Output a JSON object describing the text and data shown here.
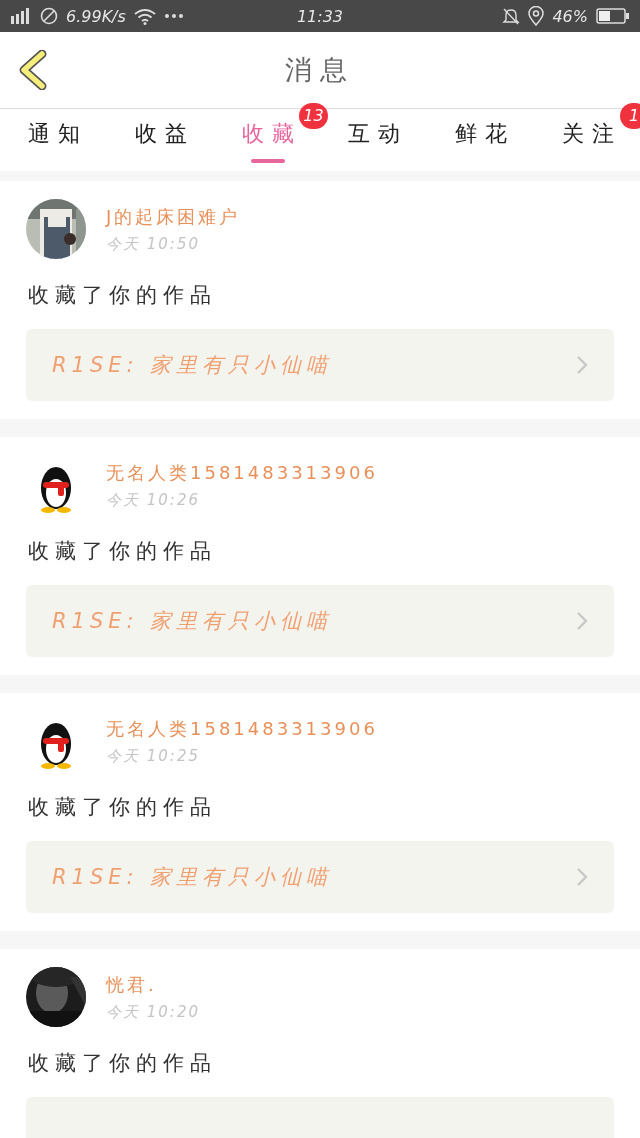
{
  "status_bar": {
    "network_speed": "6.99K/s",
    "time": "11:33",
    "battery_percent": "46%"
  },
  "header": {
    "title": "消息"
  },
  "tabs": [
    {
      "label": "通知",
      "selected": false
    },
    {
      "label": "收益",
      "selected": false
    },
    {
      "label": "收藏",
      "selected": true,
      "badge": "13"
    },
    {
      "label": "互动",
      "selected": false
    },
    {
      "label": "鲜花",
      "selected": false
    },
    {
      "label": "关注",
      "selected": false,
      "badge": "1"
    }
  ],
  "messages": [
    {
      "name": "J的起床困难户",
      "time": "今天 10:50",
      "action": "收藏了你的作品",
      "link": {
        "visible": true,
        "title": "R1SE: 家里有只小仙喵"
      }
    },
    {
      "avatar": {
        "kind": "default"
      },
      "name": "无名人类1581483313906",
      "time": "今天 10:26",
      "action": "收藏了你的作品",
      "link": {
        "visible": true,
        "title": "R1SE: 家里有只小仙喵"
      }
    },
    {
      "avatar": {
        "kind": "default"
      },
      "name": "无名人类1581483313906",
      "time": "今天 10:25",
      "action": "收藏了你的作品",
      "link": {
        "visible": true,
        "title": "R1SE: 家里有只小仙喵"
      }
    },
    {
      "name": "恍君.",
      "time": "今天 10:20",
      "action": "收藏了你的作品",
      "link": {
        "visible": false
      }
    }
  ]
}
